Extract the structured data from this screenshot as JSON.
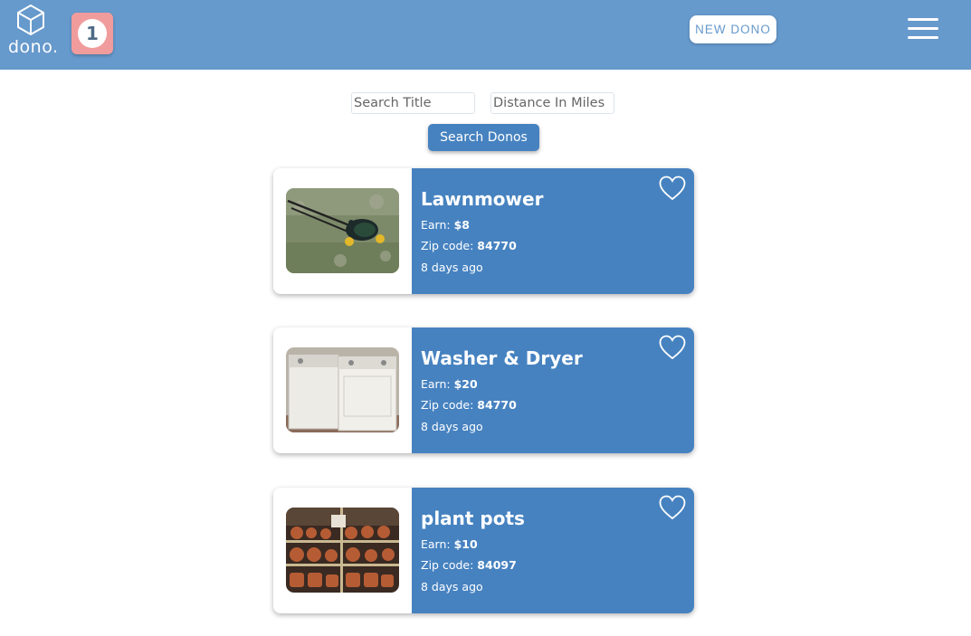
{
  "header": {
    "logo_text": "dono.",
    "notification_count": "1",
    "new_dono_label": "NEW DONO",
    "menu_icon": "hamburger-menu-icon"
  },
  "search": {
    "title_placeholder": "Search Title",
    "title_value": "",
    "distance_placeholder": "Distance In Miles",
    "distance_value": "",
    "button_label": "Search Donos"
  },
  "donos": [
    {
      "title": "Lawnmower",
      "earn_label": "Earn:",
      "earn_value": "$8",
      "zip_label": "Zip code:",
      "zip_value": "84770",
      "age": "8 days ago",
      "favorite_icon": "heart-outline-icon"
    },
    {
      "title": "Washer & Dryer",
      "earn_label": "Earn:",
      "earn_value": "$20",
      "zip_label": "Zip code:",
      "zip_value": "84770",
      "age": "8 days ago",
      "favorite_icon": "heart-outline-icon"
    },
    {
      "title": "plant pots",
      "earn_label": "Earn:",
      "earn_value": "$10",
      "zip_label": "Zip code:",
      "zip_value": "84097",
      "age": "8 days ago",
      "favorite_icon": "heart-outline-icon"
    }
  ],
  "colors": {
    "header": "#6699cc",
    "accent": "#4682c0",
    "badge": "#f19c9c"
  }
}
